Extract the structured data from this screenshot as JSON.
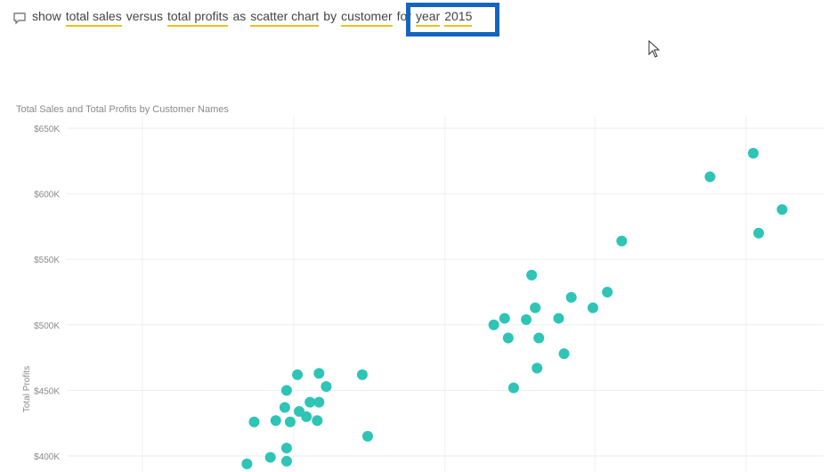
{
  "qa": {
    "tokens": [
      {
        "text": "show",
        "highlight": false
      },
      {
        "text": "total sales",
        "highlight": true
      },
      {
        "text": "versus",
        "highlight": false
      },
      {
        "text": "total profits",
        "highlight": true
      },
      {
        "text": "as",
        "highlight": false
      },
      {
        "text": "scatter chart",
        "highlight": true
      },
      {
        "text": "by",
        "highlight": false
      },
      {
        "text": "customer",
        "highlight": true
      },
      {
        "text": "for",
        "highlight": false
      },
      {
        "text": "year",
        "highlight": true
      },
      {
        "text": "2015",
        "highlight": true
      }
    ]
  },
  "colors": {
    "point": "#2ec4b6",
    "highlight_underline": "#e8c21a",
    "focus_box": "#1565c0"
  },
  "chart_data": {
    "type": "scatter",
    "title": "Total Sales and Total Profits by Customer Names",
    "ylabel": "Total Profits",
    "xlabel": "",
    "ylim": [
      400000,
      650000
    ],
    "yticks": [
      400000,
      450000,
      500000,
      550000,
      600000,
      650000
    ],
    "ytick_labels": [
      "$400K",
      "$450K",
      "$500K",
      "$550K",
      "$600K",
      "$650K"
    ],
    "grid": true,
    "points": [
      {
        "x": 1.0,
        "y": 394000
      },
      {
        "x": 1.04,
        "y": 426000
      },
      {
        "x": 1.13,
        "y": 399000
      },
      {
        "x": 1.16,
        "y": 427000
      },
      {
        "x": 1.21,
        "y": 437000
      },
      {
        "x": 1.22,
        "y": 450000
      },
      {
        "x": 1.22,
        "y": 406000
      },
      {
        "x": 1.22,
        "y": 396000
      },
      {
        "x": 1.24,
        "y": 426000
      },
      {
        "x": 1.28,
        "y": 462000
      },
      {
        "x": 1.29,
        "y": 434000
      },
      {
        "x": 1.33,
        "y": 430000
      },
      {
        "x": 1.35,
        "y": 441000
      },
      {
        "x": 1.39,
        "y": 427000
      },
      {
        "x": 1.4,
        "y": 441000
      },
      {
        "x": 1.4,
        "y": 463000
      },
      {
        "x": 1.44,
        "y": 453000
      },
      {
        "x": 1.64,
        "y": 462000
      },
      {
        "x": 1.67,
        "y": 415000
      },
      {
        "x": 2.37,
        "y": 500000
      },
      {
        "x": 2.43,
        "y": 505000
      },
      {
        "x": 2.45,
        "y": 490000
      },
      {
        "x": 2.48,
        "y": 452000
      },
      {
        "x": 2.55,
        "y": 504000
      },
      {
        "x": 2.58,
        "y": 538000
      },
      {
        "x": 2.6,
        "y": 513000
      },
      {
        "x": 2.61,
        "y": 467000
      },
      {
        "x": 2.62,
        "y": 490000
      },
      {
        "x": 2.73,
        "y": 505000
      },
      {
        "x": 2.76,
        "y": 478000
      },
      {
        "x": 2.8,
        "y": 521000
      },
      {
        "x": 2.92,
        "y": 513000
      },
      {
        "x": 3.0,
        "y": 525000
      },
      {
        "x": 3.08,
        "y": 564000
      },
      {
        "x": 3.57,
        "y": 613000
      },
      {
        "x": 3.81,
        "y": 631000
      },
      {
        "x": 3.84,
        "y": 570000
      },
      {
        "x": 3.97,
        "y": 588000
      }
    ]
  }
}
